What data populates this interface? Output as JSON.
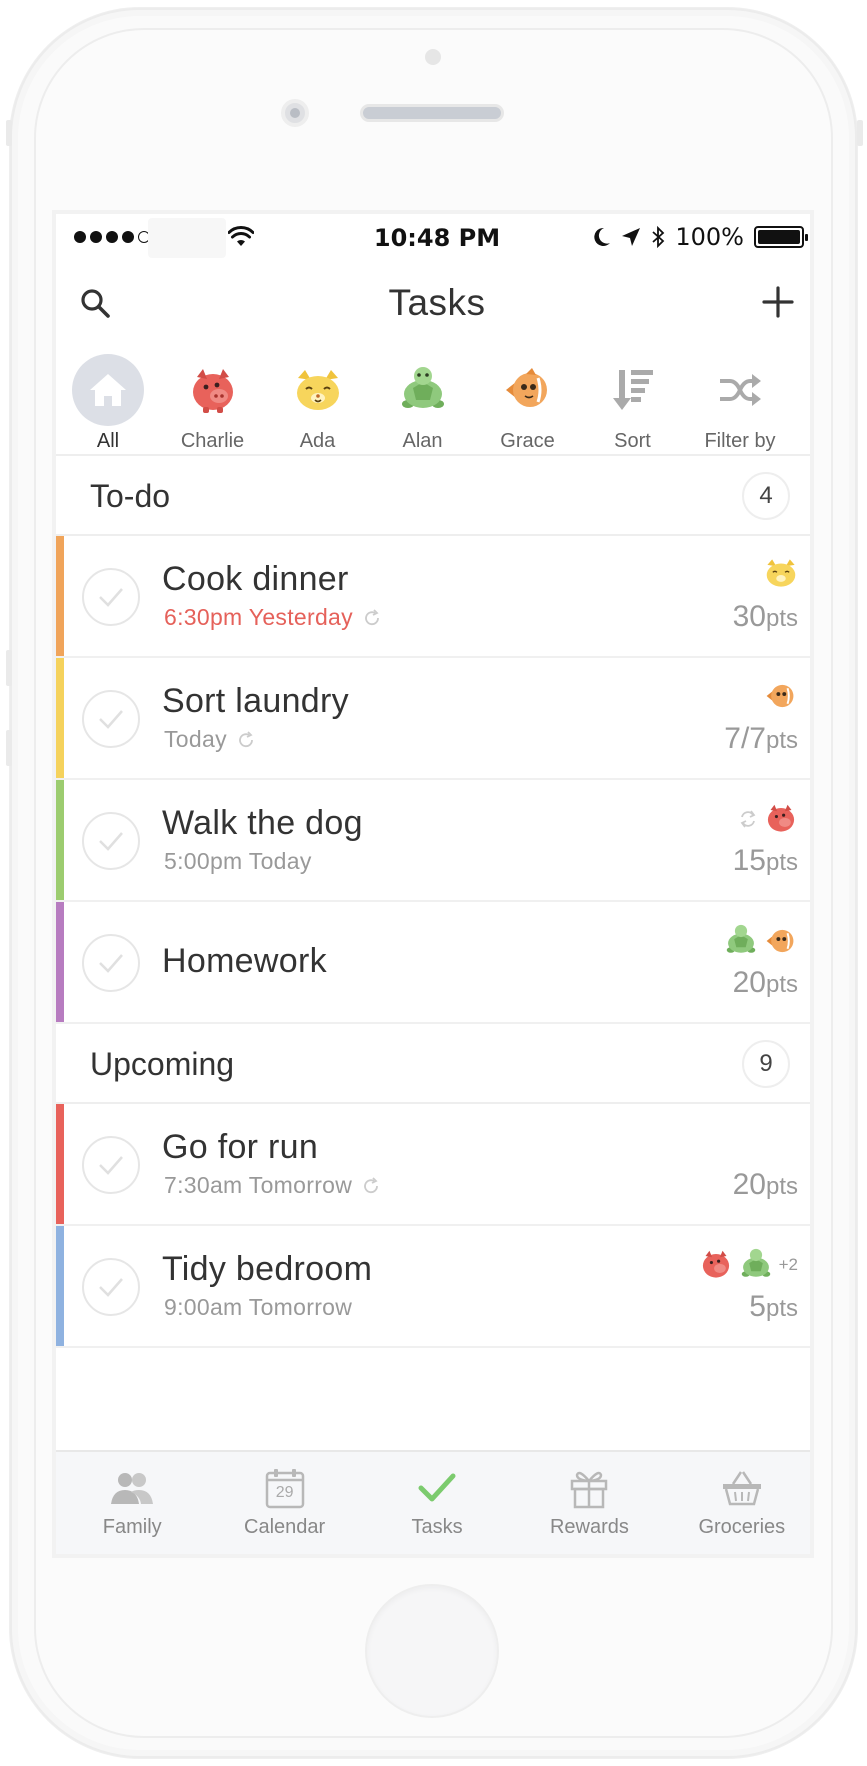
{
  "status": {
    "time": "10:48 PM",
    "battery": "100%"
  },
  "header": {
    "title": "Tasks"
  },
  "filters": [
    {
      "label": "All"
    },
    {
      "label": "Charlie"
    },
    {
      "label": "Ada"
    },
    {
      "label": "Alan"
    },
    {
      "label": "Grace"
    },
    {
      "label": "Sort"
    },
    {
      "label": "Filter by"
    }
  ],
  "todo": {
    "title": "To-do",
    "count": "4",
    "tasks": [
      {
        "title": "Cook dinner",
        "subtitle": "6:30pm Yesterday",
        "pts_num": "30",
        "pts_unit": "pts",
        "color": "#f0a45a"
      },
      {
        "title": "Sort laundry",
        "subtitle": "Today",
        "pts_num": "7/7",
        "pts_unit": "pts",
        "color": "#f5d25c"
      },
      {
        "title": "Walk the dog",
        "subtitle": "5:00pm Today",
        "pts_num": "15",
        "pts_unit": "pts",
        "color": "#9ccc6f"
      },
      {
        "title": "Homework",
        "subtitle": "",
        "pts_num": "20",
        "pts_unit": "pts",
        "color": "#b77cc0"
      }
    ]
  },
  "upcoming": {
    "title": "Upcoming",
    "count": "9",
    "tasks": [
      {
        "title": "Go for run",
        "subtitle": "7:30am Tomorrow",
        "pts_num": "20",
        "pts_unit": "pts",
        "color": "#e8625b"
      },
      {
        "title": "Tidy bedroom",
        "subtitle": "9:00am Tomorrow",
        "pts_num": "5",
        "pts_unit": "pts",
        "more": "+2",
        "color": "#8fb2e0"
      }
    ]
  },
  "tabs": [
    {
      "label": "Family",
      "icon": "family-icon"
    },
    {
      "label": "Calendar",
      "icon": "calendar-icon",
      "day": "29"
    },
    {
      "label": "Tasks",
      "icon": "check-icon"
    },
    {
      "label": "Rewards",
      "icon": "gift-icon"
    },
    {
      "label": "Groceries",
      "icon": "basket-icon"
    }
  ],
  "colors": {
    "overdue": "#e5615a",
    "active_tab": "#7ccb6e",
    "charlie": "#e8625b",
    "ada": "#f7d55c",
    "alan": "#8fc97d",
    "grace": "#f2a65c"
  }
}
